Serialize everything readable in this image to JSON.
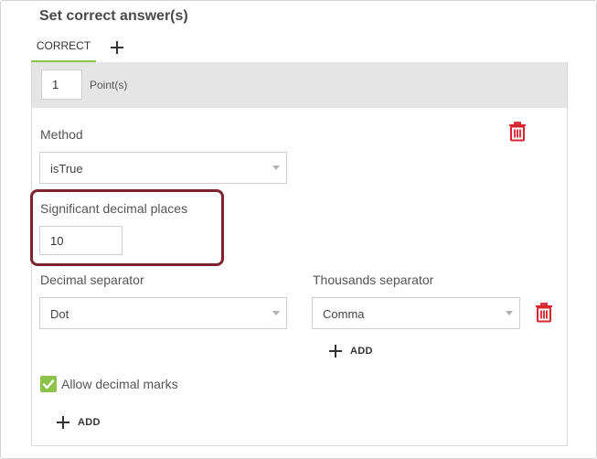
{
  "heading": "Set correct answer(s)",
  "tabs": {
    "correct_label": "CORRECT"
  },
  "points": {
    "value": "1",
    "label": "Point(s)"
  },
  "method": {
    "label": "Method",
    "selected": "isTrue"
  },
  "significant": {
    "label": "Significant decimal places",
    "value": "10"
  },
  "decimal_separator": {
    "label": "Decimal separator",
    "selected": "Dot"
  },
  "thousands_separator": {
    "label": "Thousands separator",
    "selected": "Comma"
  },
  "add_thousands_label": "ADD",
  "allow_decimal_marks": {
    "label": "Allow decimal marks",
    "checked": true
  },
  "add_label": "ADD",
  "colors": {
    "accent_green": "#8bc34a",
    "delete_red": "#d9232f",
    "highlight": "#7d2431"
  }
}
